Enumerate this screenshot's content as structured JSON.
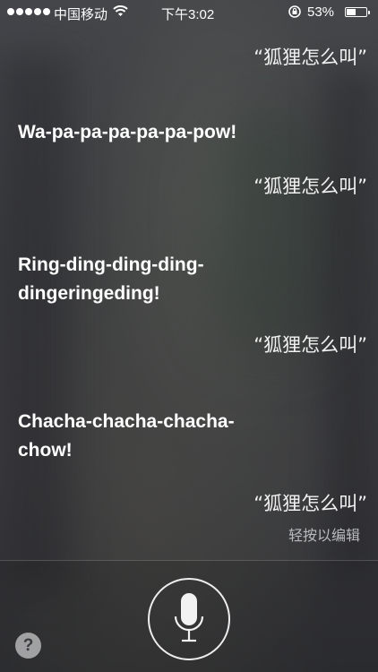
{
  "status_bar": {
    "carrier": "中国移动",
    "time": "下午3:02",
    "battery": "53%",
    "battery_level": 0.53,
    "icons": [
      "signal-dots-icon",
      "wifi-icon",
      "rotation-lock-icon",
      "battery-icon"
    ]
  },
  "conversation": [
    {
      "type": "user",
      "text": "“狐狸怎么叫”"
    },
    {
      "type": "siri",
      "text": "Wa-pa-pa-pa-pa-pa-pow!"
    },
    {
      "type": "user",
      "text": "“狐狸怎么叫”"
    },
    {
      "type": "siri",
      "lines": [
        "Ring-ding-ding-ding-",
        "dingeringeding!"
      ]
    },
    {
      "type": "user",
      "text": "“狐狸怎么叫”"
    },
    {
      "type": "siri",
      "lines": [
        "Chacha-chacha-chacha-",
        "chow!"
      ]
    },
    {
      "type": "user",
      "text": "“狐狸怎么叫”"
    }
  ],
  "edit_hint": "轻按以编辑",
  "controls": {
    "mic_icon": "microphone-icon",
    "help_label": "?"
  }
}
